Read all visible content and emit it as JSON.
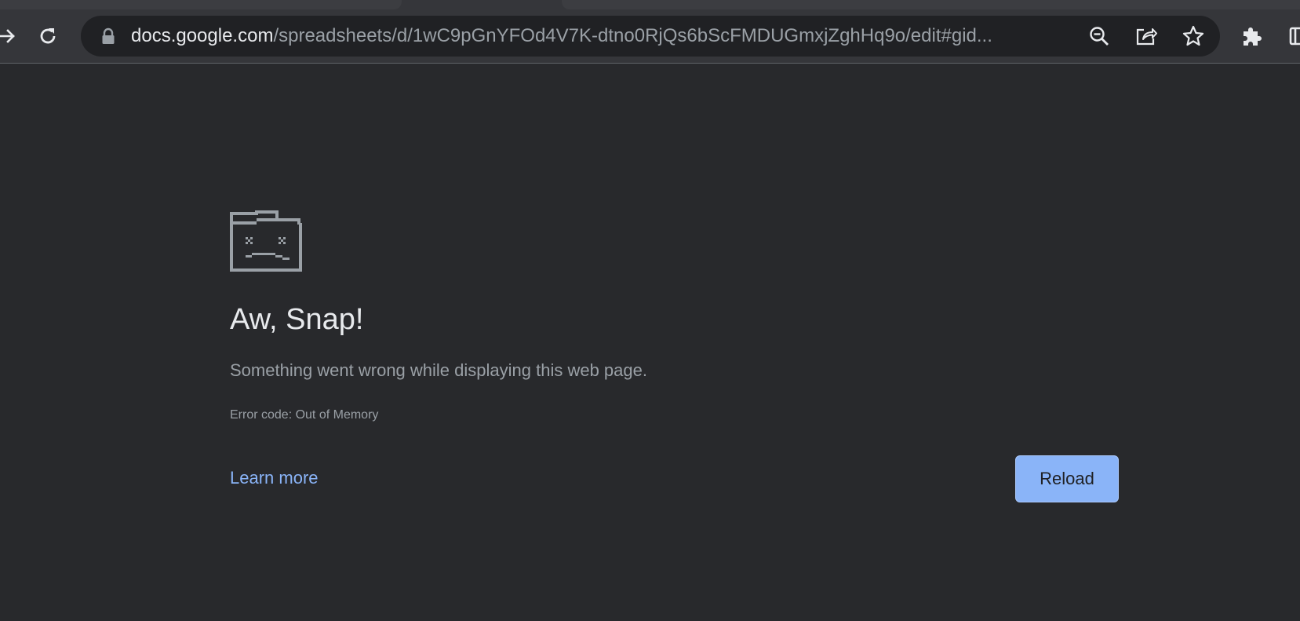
{
  "browser": {
    "url_host": "docs.google.com",
    "url_path": "/spreadsheets/d/1wC9pGnYFOd4V7K-dtno0RjQs6bScFMDUGmxjZghHq9o/edit#gid...",
    "icons": [
      "forward-icon",
      "reload-icon",
      "lock-icon",
      "zoom-out-icon",
      "share-icon",
      "bookmark-star-icon",
      "extensions-icon",
      "side-panel-icon"
    ]
  },
  "error_page": {
    "title": "Aw, Snap!",
    "message": "Something went wrong while displaying this web page.",
    "error_code": "Error code: Out of Memory",
    "learn_more": "Learn more",
    "reload": "Reload"
  },
  "colors": {
    "page_background": "#28292c",
    "toolbar_background": "#35363a",
    "omnibox_background": "#202124",
    "link": "#8ab4f8",
    "button": "#8ab4f8"
  }
}
